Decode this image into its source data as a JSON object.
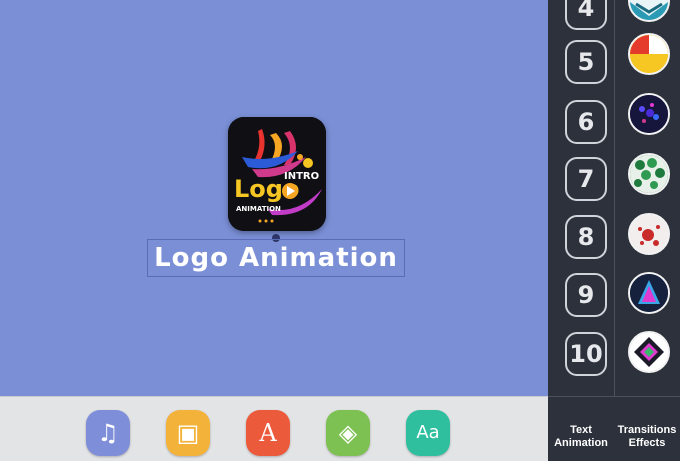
{
  "canvas": {
    "logo_title": "Logo Animation",
    "app_icon": {
      "name": "logo-intro-animation-icon",
      "text_logo": "Logo",
      "text_intro": "INTRO",
      "text_animation": "ANIMATION"
    }
  },
  "toolbar": {
    "tools": [
      {
        "name": "music-icon",
        "glyph": "♫",
        "color": "#7e8ed8"
      },
      {
        "name": "gallery-icon",
        "glyph": "▣",
        "color": "#f3b23a"
      },
      {
        "name": "font-icon",
        "glyph": "A",
        "color": "#ec5a3c"
      },
      {
        "name": "paint-bucket-icon",
        "glyph": "◈",
        "color": "#7dc152"
      },
      {
        "name": "text-style-icon",
        "glyph": "Aa",
        "color": "#2fbf9e"
      }
    ]
  },
  "sidebar": {
    "numbers": [
      "4",
      "5",
      "6",
      "7",
      "8",
      "9",
      "10"
    ],
    "effects": [
      "geometric-effect",
      "pie-effect",
      "particles-effect",
      "green-dots-effect",
      "red-splash-effect",
      "shards-effect",
      "diamond-effect"
    ],
    "text_animation_label": "Text Animation",
    "transitions_label": "Transitions Effects"
  },
  "colors": {
    "canvas_bg": "#7a8fd6",
    "sidebar_bg": "#2c313b",
    "bottom_bg": "#e3e4e6"
  }
}
